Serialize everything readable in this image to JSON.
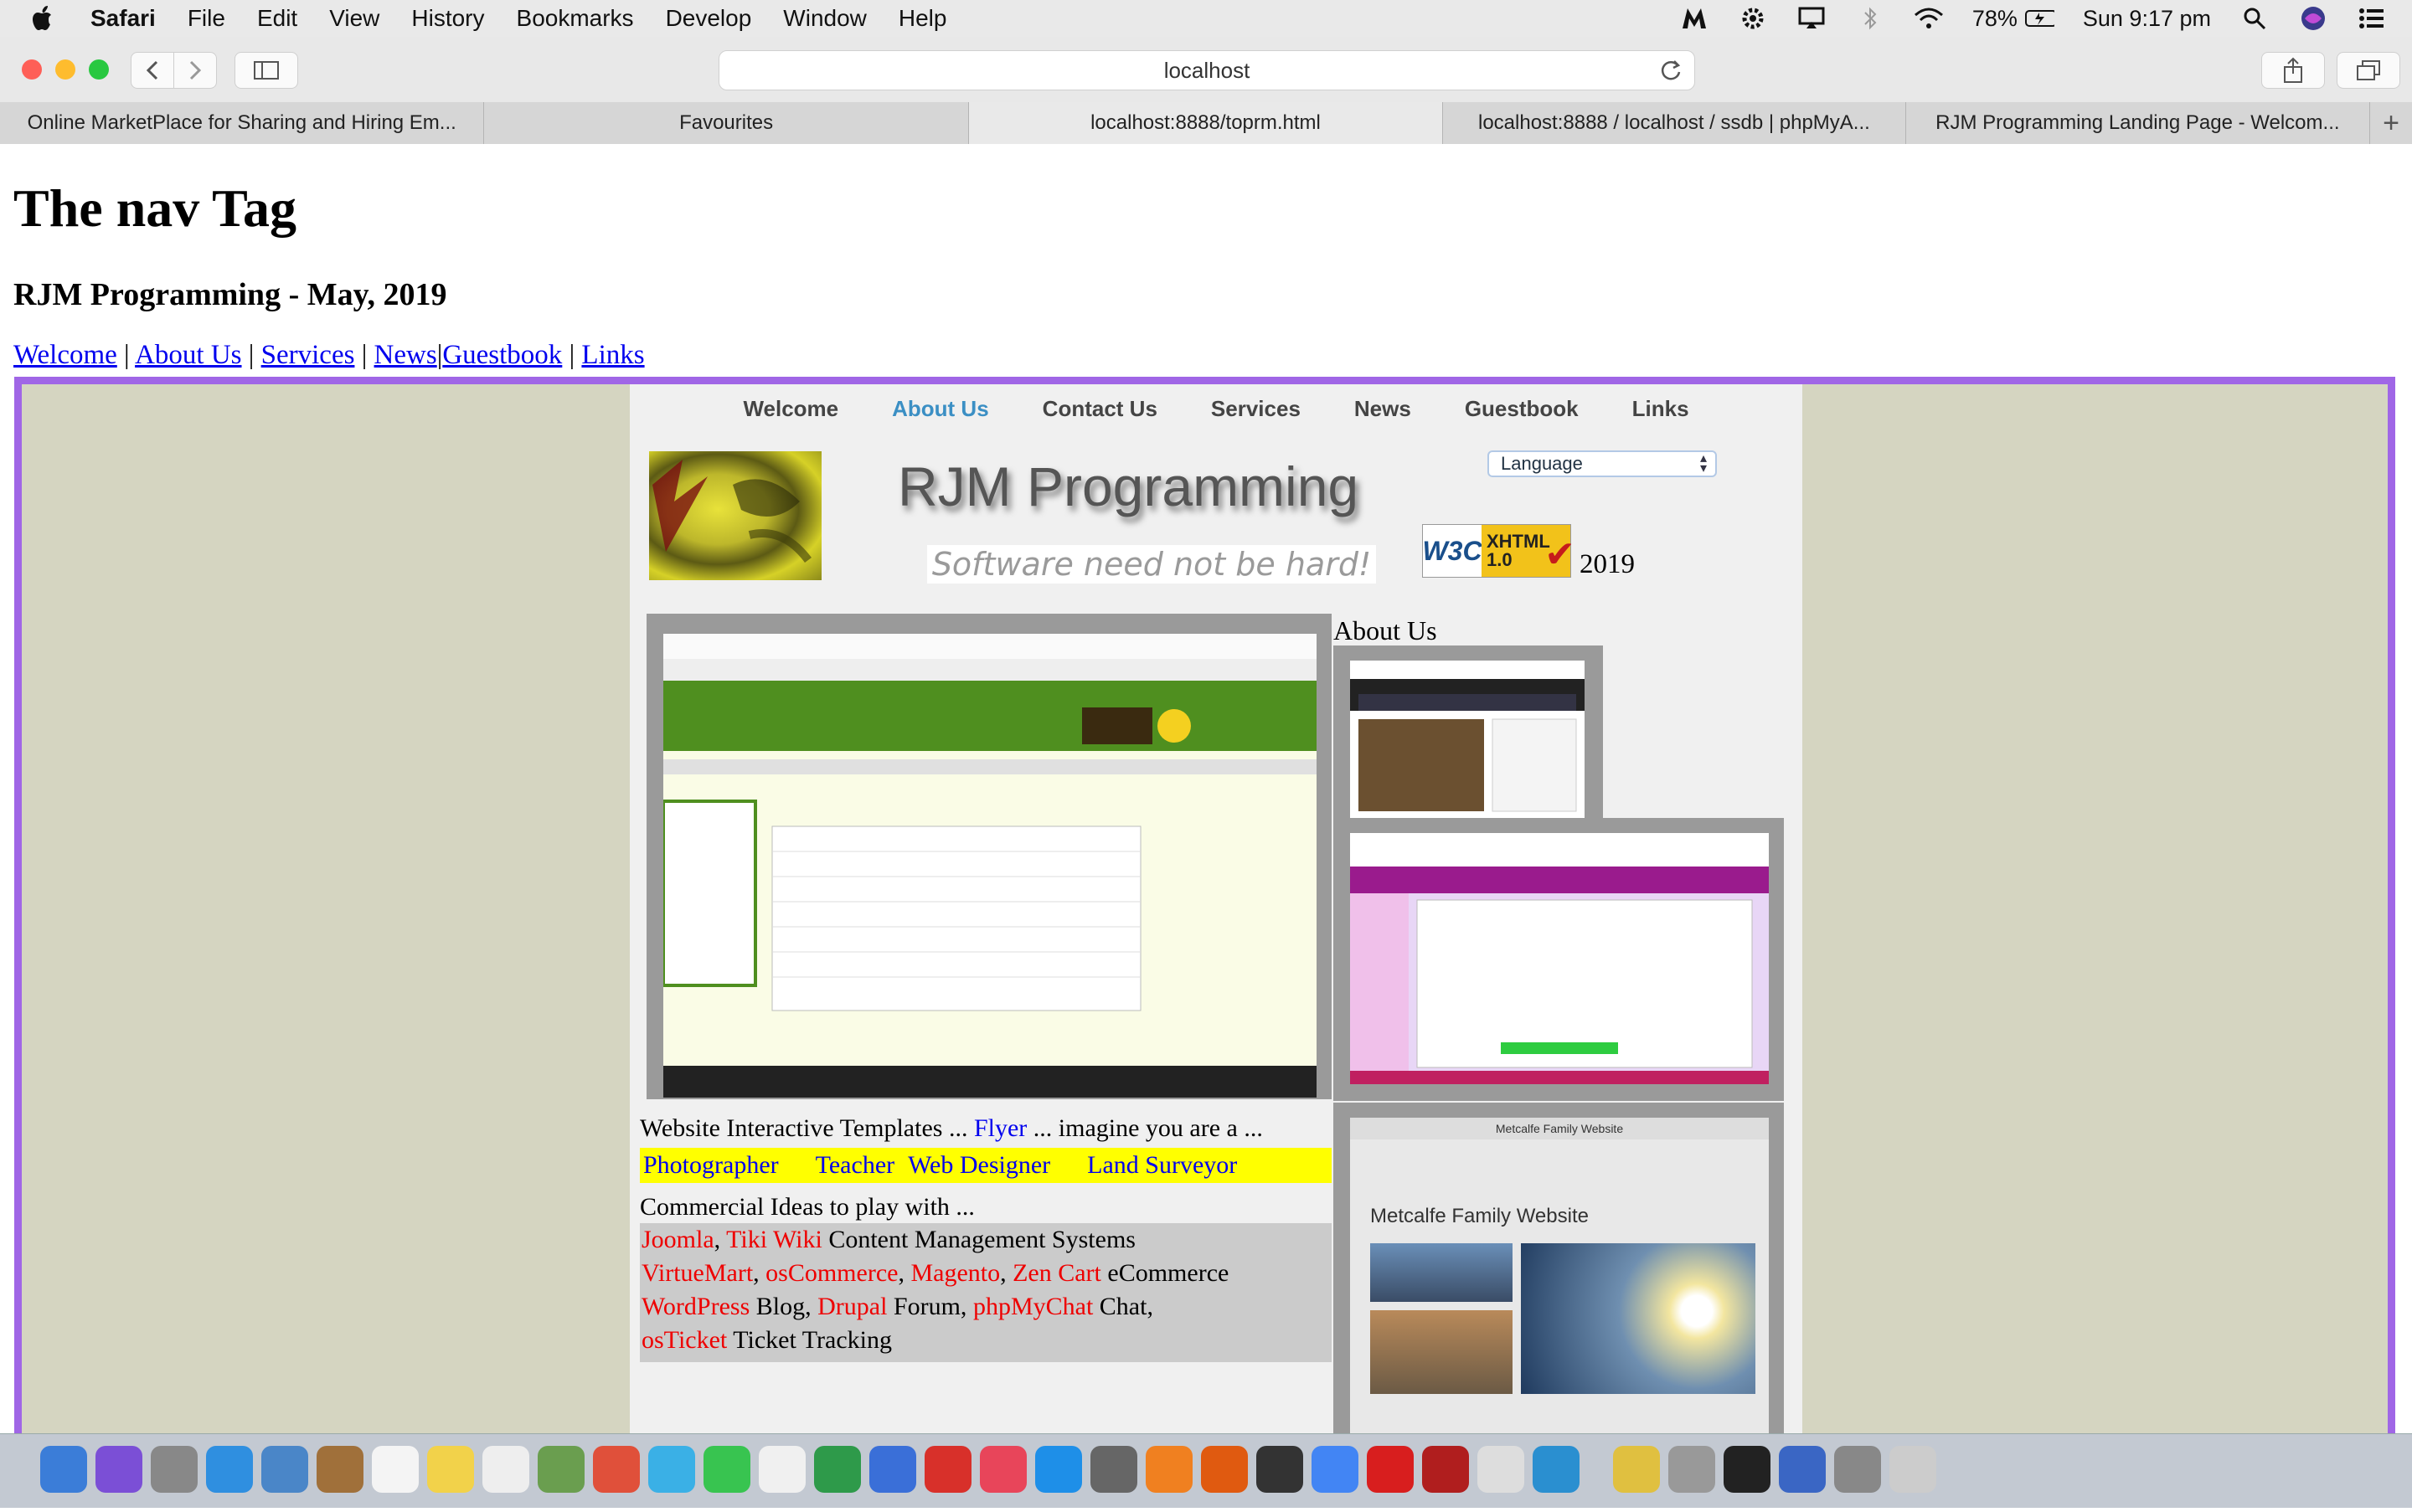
{
  "menubar": {
    "app": "Safari",
    "items": [
      "File",
      "Edit",
      "View",
      "History",
      "Bookmarks",
      "Develop",
      "Window",
      "Help"
    ],
    "battery": "78%",
    "clock": "Sun 9:17 pm"
  },
  "toolbar": {
    "url": "localhost"
  },
  "tabs": [
    "Online MarketPlace for Sharing and Hiring Em...",
    "Favourites",
    "localhost:8888/toprm.html",
    "localhost:8888 / localhost / ssdb | phpMyA...",
    "RJM Programming Landing Page - Welcom..."
  ],
  "page": {
    "title": "The nav Tag",
    "subtitle": "RJM Programming - May, 2019",
    "nav_links": [
      "Welcome",
      "About Us",
      "Services",
      "News",
      "Guestbook",
      "Links"
    ],
    "inner_nav": [
      "Welcome",
      "About Us",
      "Contact Us",
      "Services",
      "News",
      "Guestbook",
      "Links"
    ],
    "brand": "RJM Programming",
    "tagline": "Software need not be hard!",
    "language_select": "Language",
    "badge_left": "W3C",
    "badge_right": "XHTML 1.0",
    "year": "2019",
    "about_label": "About Us",
    "screenshot_title": "Metcalfe Family Website",
    "screenshot_header": "Metcalfe Family Website",
    "templates_text_1": "Website Interactive Templates ... ",
    "templates_link": "Flyer",
    "templates_text_2": " ... imagine you are a ...",
    "roles": [
      "Photographer",
      "Teacher",
      "Web Designer",
      "Land Surveyor"
    ],
    "commercial_intro": "Commercial Ideas to play with ...",
    "cms": [
      "Joomla",
      "Tiki Wiki"
    ],
    "cms_label": " Content Management Systems",
    "ecommerce": [
      "VirtueMart",
      "osCommerce",
      "Magento",
      "Zen Cart"
    ],
    "ecommerce_label": " eCommerce",
    "blog_link": "WordPress",
    "blog_label": " Blog, ",
    "forum_link": "Drupal",
    "forum_label": " Forum, ",
    "chat_link": "phpMyChat",
    "chat_label": " Chat,",
    "ticket_link": "osTicket",
    "ticket_label": " Ticket Tracking"
  },
  "colors": {
    "frame_border": "#a066e6",
    "frame_bg": "#d5d5c1",
    "inner_bg": "#f0f0f0",
    "active_nav": "#3b8fc4",
    "highlight": "#ffff00",
    "commercial_link": "#ee0000"
  }
}
